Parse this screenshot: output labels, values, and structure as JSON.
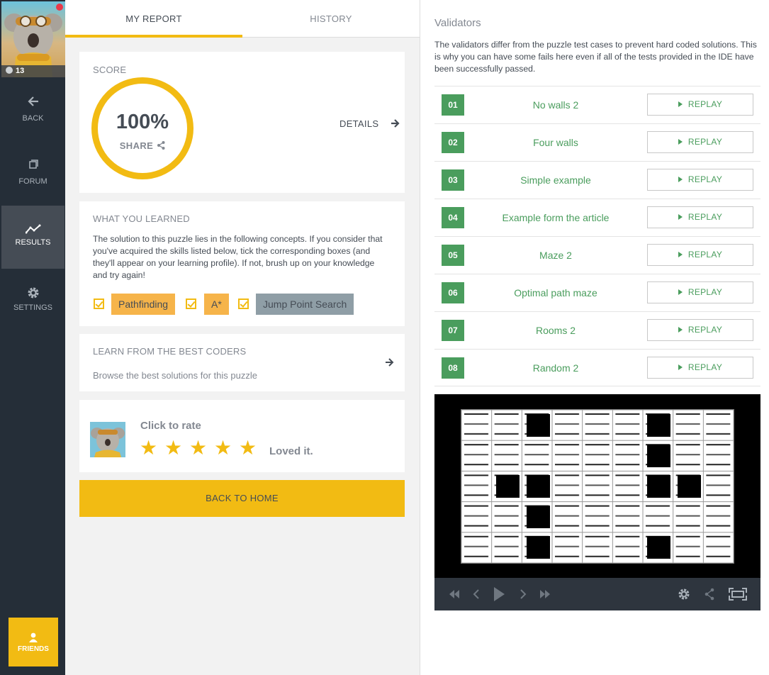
{
  "sidebar": {
    "level": "13",
    "items": [
      {
        "label": "BACK",
        "icon": "arrow-left-icon"
      },
      {
        "label": "FORUM",
        "icon": "forum-icon"
      },
      {
        "label": "RESULTS",
        "icon": "results-chart-icon"
      },
      {
        "label": "SETTINGS",
        "icon": "gear-icon"
      }
    ],
    "friends_label": "FRIENDS"
  },
  "tabs": [
    {
      "label": "MY REPORT",
      "active": true
    },
    {
      "label": "HISTORY",
      "active": false
    }
  ],
  "score": {
    "title": "SCORE",
    "value": "100%",
    "share_label": "SHARE",
    "details_label": "DETAILS"
  },
  "learned": {
    "title": "WHAT YOU LEARNED",
    "text": "The solution to this puzzle lies in the following concepts. If you consider that you've acquired the skills listed below, tick the corresponding boxes (and they'll appear on your learning profile). If not, brush up on your knowledge and try again!",
    "concepts": [
      "Pathfinding",
      "A*",
      "Jump Point Search"
    ]
  },
  "coders": {
    "title": "LEARN FROM THE BEST CODERS",
    "subtitle": "Browse the best solutions for this puzzle"
  },
  "rating": {
    "prompt": "Click to rate",
    "value": 5,
    "max": 5,
    "label": "Loved it."
  },
  "back_home_label": "BACK TO HOME",
  "validators": {
    "title": "Validators",
    "description": "The validators differ from the puzzle test cases to prevent hard coded solutions. This is why you can have some fails here even if all of the tests provided in the IDE have been successfully passed.",
    "replay_label": "REPLAY",
    "items": [
      {
        "num": "01",
        "name": "No walls 2"
      },
      {
        "num": "02",
        "name": "Four walls"
      },
      {
        "num": "03",
        "name": "Simple example"
      },
      {
        "num": "04",
        "name": "Example form the article"
      },
      {
        "num": "05",
        "name": "Maze 2"
      },
      {
        "num": "06",
        "name": "Optimal path maze"
      },
      {
        "num": "07",
        "name": "Rooms 2"
      },
      {
        "num": "08",
        "name": "Random 2"
      }
    ]
  },
  "colors": {
    "accent": "#f2bb13",
    "sidebar": "#252e38",
    "validator_green": "#4a9d5d"
  }
}
